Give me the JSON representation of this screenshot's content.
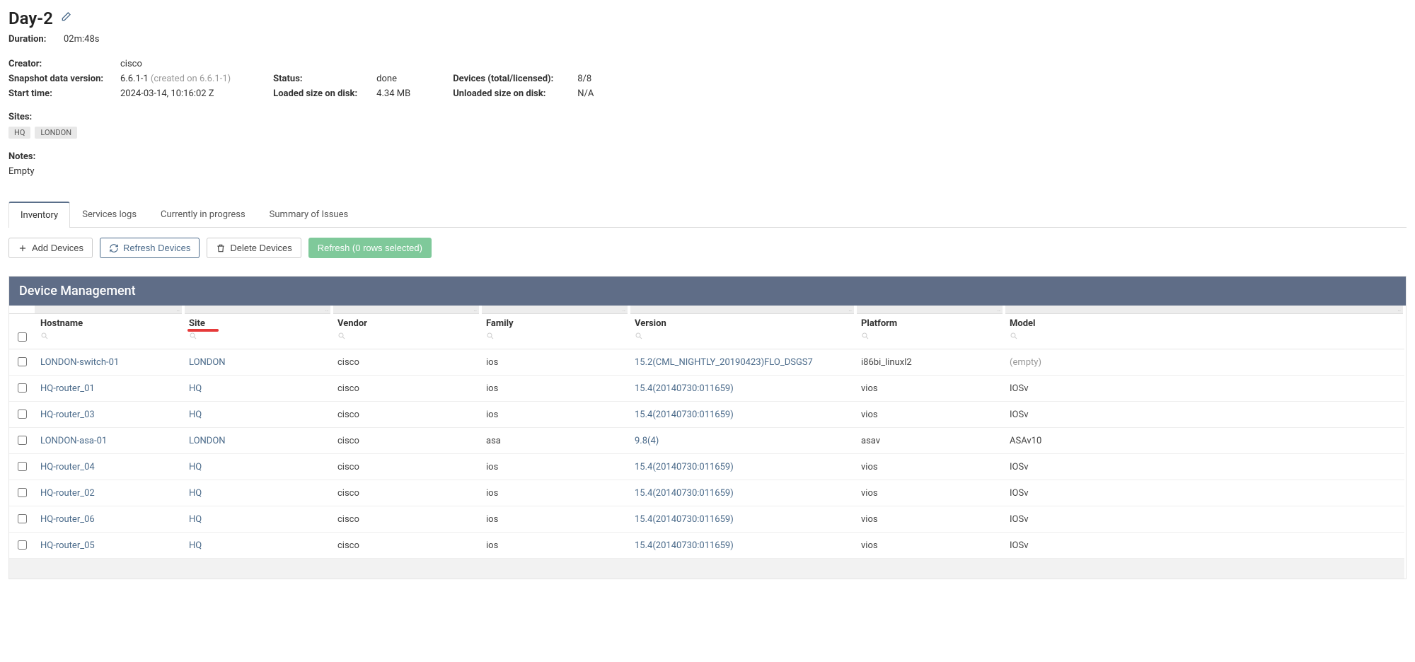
{
  "header": {
    "title": "Day-2",
    "duration_label": "Duration:",
    "duration_value": "02m:48s",
    "creator_label": "Creator:",
    "creator_value": "cisco"
  },
  "meta": {
    "snapshot_label": "Snapshot data version:",
    "snapshot_value": "6.6.1-1",
    "snapshot_suffix": "(created on 6.6.1-1)",
    "start_time_label": "Start time:",
    "start_time_value": "2024-03-14, 10:16:02 Z",
    "status_label": "Status:",
    "status_value": "done",
    "loaded_size_label": "Loaded size on disk:",
    "loaded_size_value": "4.34 MB",
    "devices_label": "Devices (total/licensed):",
    "devices_value": "8/8",
    "unloaded_size_label": "Unloaded size on disk:",
    "unloaded_size_value": "N/A"
  },
  "sites": {
    "label": "Sites:",
    "items": [
      "HQ",
      "LONDON"
    ]
  },
  "notes": {
    "label": "Notes:",
    "value": "Empty"
  },
  "tabs": {
    "items": [
      "Inventory",
      "Services logs",
      "Currently in progress",
      "Summary of Issues"
    ],
    "active": 0
  },
  "toolbar": {
    "add": "Add Devices",
    "refresh": "Refresh Devices",
    "delete": "Delete Devices",
    "refresh_selected": "Refresh (0 rows selected)"
  },
  "table": {
    "title": "Device Management",
    "columns": {
      "hostname": "Hostname",
      "site": "Site",
      "vendor": "Vendor",
      "family": "Family",
      "version": "Version",
      "platform": "Platform",
      "model": "Model"
    },
    "rows": [
      {
        "hostname": "LONDON-switch-01",
        "site": "LONDON",
        "vendor": "cisco",
        "family": "ios",
        "version": "15.2(CML_NIGHTLY_20190423)FLO_DSGS7",
        "platform": "i86bi_linuxl2",
        "model": "(empty)",
        "model_muted": true
      },
      {
        "hostname": "HQ-router_01",
        "site": "HQ",
        "vendor": "cisco",
        "family": "ios",
        "version": "15.4(20140730:011659)",
        "platform": "vios",
        "model": "IOSv"
      },
      {
        "hostname": "HQ-router_03",
        "site": "HQ",
        "vendor": "cisco",
        "family": "ios",
        "version": "15.4(20140730:011659)",
        "platform": "vios",
        "model": "IOSv"
      },
      {
        "hostname": "LONDON-asa-01",
        "site": "LONDON",
        "vendor": "cisco",
        "family": "asa",
        "version": "9.8(4)",
        "platform": "asav",
        "model": "ASAv10"
      },
      {
        "hostname": "HQ-router_04",
        "site": "HQ",
        "vendor": "cisco",
        "family": "ios",
        "version": "15.4(20140730:011659)",
        "platform": "vios",
        "model": "IOSv"
      },
      {
        "hostname": "HQ-router_02",
        "site": "HQ",
        "vendor": "cisco",
        "family": "ios",
        "version": "15.4(20140730:011659)",
        "platform": "vios",
        "model": "IOSv"
      },
      {
        "hostname": "HQ-router_06",
        "site": "HQ",
        "vendor": "cisco",
        "family": "ios",
        "version": "15.4(20140730:011659)",
        "platform": "vios",
        "model": "IOSv"
      },
      {
        "hostname": "HQ-router_05",
        "site": "HQ",
        "vendor": "cisco",
        "family": "ios",
        "version": "15.4(20140730:011659)",
        "platform": "vios",
        "model": "IOSv"
      }
    ]
  }
}
